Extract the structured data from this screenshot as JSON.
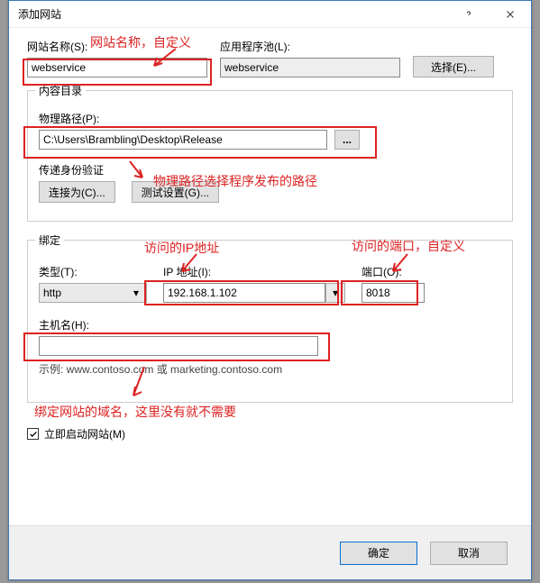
{
  "title": "添加网站",
  "site_name_label": "网站名称(S):",
  "app_pool_label": "应用程序池(L):",
  "select_btn": "选择(E)...",
  "site_name_value": "webservice",
  "app_pool_value": "webservice",
  "content_group": "内容目录",
  "phys_path_label": "物理路径(P):",
  "phys_path_value": "C:\\Users\\Brambling\\Desktop\\Release",
  "browse": "...",
  "auth_label": "传递身份验证",
  "connect_as_btn": "连接为(C)...",
  "test_settings_btn": "测试设置(G)...",
  "binding_group": "绑定",
  "type_label": "类型(T):",
  "type_value": "http",
  "ip_label": "IP 地址(I):",
  "ip_value": "192.168.1.102",
  "port_label": "端口(O):",
  "port_value": "8018",
  "host_label": "主机名(H):",
  "host_value": "",
  "example_text": "示例: www.contoso.com 或 marketing.contoso.com",
  "start_now": "立即启动网站(M)",
  "ok": "确定",
  "cancel": "取消",
  "anno": {
    "site_name": "网站名称，自定义",
    "path": "物理路径选择程序发布的路径",
    "ip": "访问的IP地址",
    "port": "访问的端口，自定义",
    "host": "绑定网站的域名，这里没有就不需要"
  }
}
